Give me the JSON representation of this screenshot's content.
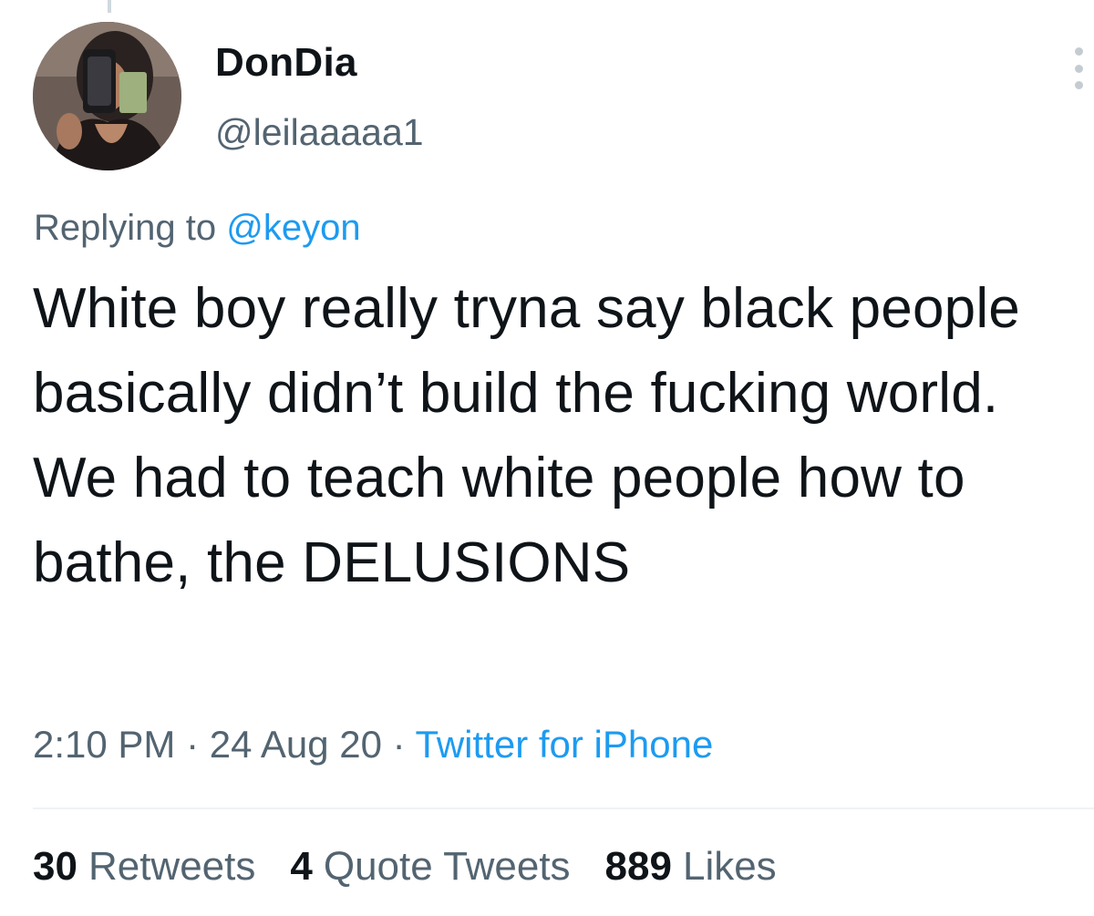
{
  "tweet": {
    "author": {
      "display_name": "DonDia",
      "handle": "@leilaaaaa1"
    },
    "reply": {
      "prefix": "Replying to",
      "mention": "@keyon"
    },
    "text": "White boy really tryna say black people basically didn’t build the fucking world. We had to teach white people how to bathe, the DELUSIONS",
    "meta": {
      "time": "2:10 PM",
      "date": "24 Aug 20",
      "separator": " · ",
      "source": "Twitter for iPhone"
    },
    "stats": {
      "retweets": {
        "count": "30",
        "label": "Retweets"
      },
      "quotes": {
        "count": "4",
        "label": "Quote Tweets"
      },
      "likes": {
        "count": "889",
        "label": "Likes"
      }
    },
    "icons": {
      "more": "more-dots-icon"
    },
    "colors": {
      "text_primary": "#0f1419",
      "text_secondary": "#536471",
      "link": "#1d9bf0",
      "divider": "#eff3f4"
    }
  }
}
